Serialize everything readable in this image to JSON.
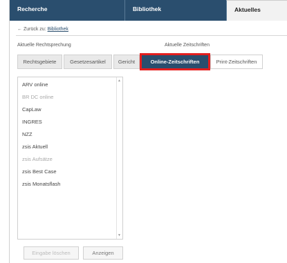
{
  "tabs": [
    {
      "label": "Recherche"
    },
    {
      "label": "Bibliothek"
    },
    {
      "label": "Aktuelles"
    }
  ],
  "back": {
    "prefix": "← Zurück zu:",
    "link": "Bibliothek"
  },
  "labels": {
    "rechtsprechung": "Aktuelle Rechtsprechung",
    "zeitschriften": "Aktuelle Zeitschriften"
  },
  "filters": [
    {
      "label": "Rechtsgebiete"
    },
    {
      "label": "Gesetzesartikel"
    },
    {
      "label": "Gericht"
    },
    {
      "label": "Online-Zeitschriften"
    },
    {
      "label": "Print-Zeitschriften"
    }
  ],
  "list": {
    "items": [
      {
        "label": "ARV online",
        "muted": false
      },
      {
        "label": "BR DC online",
        "muted": true
      },
      {
        "label": "CapLaw",
        "muted": false
      },
      {
        "label": "INGRES",
        "muted": false
      },
      {
        "label": "NZZ",
        "muted": false
      },
      {
        "label": "zsis Aktuell",
        "muted": false
      },
      {
        "label": "zsis Aufsätze",
        "muted": true
      },
      {
        "label": "zsis Best Case",
        "muted": false
      },
      {
        "label": "zsis Monatsflash",
        "muted": false
      }
    ]
  },
  "actions": {
    "clear": "Eingabe löschen",
    "show": "Anzeigen"
  },
  "colors": {
    "accent": "#2a4e6e",
    "highlight": "#e41e1e"
  }
}
